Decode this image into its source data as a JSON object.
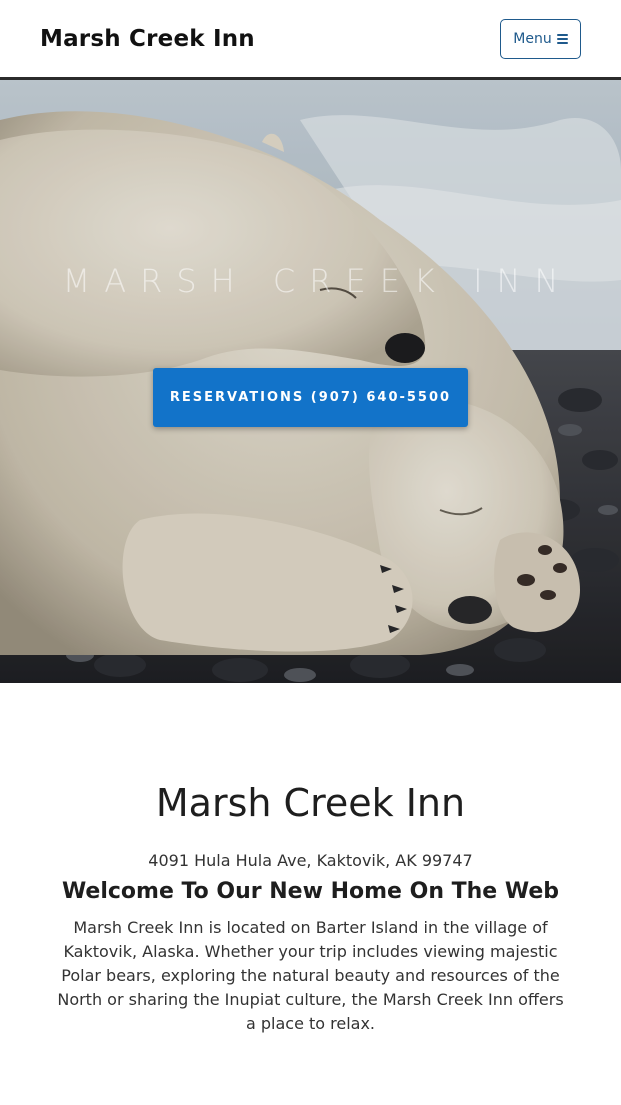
{
  "navbar": {
    "brand": "Marsh Creek Inn",
    "menu_label": "Menu",
    "menu_icon": "hamburger-icon"
  },
  "hero": {
    "title": "MARSH CREEK INN",
    "reservation_button": "RESERVATIONS (907) 640-5500",
    "image": "polar-bears-photo"
  },
  "main": {
    "title": "Marsh Creek Inn",
    "address": "4091 Hula Hula Ave, Kaktovik, AK 99747",
    "heading": "Welcome To Our New Home On The Web",
    "description": "Marsh Creek Inn is located on Barter Island in the village of Kaktovik, Alaska. Whether your trip includes viewing majestic Polar bears, exploring the natural beauty and resources of the North or sharing the Inupiat culture, the Marsh Creek Inn offers a place to relax."
  },
  "colors": {
    "accent": "#1273c9",
    "menu_border": "#1f5a8c"
  }
}
